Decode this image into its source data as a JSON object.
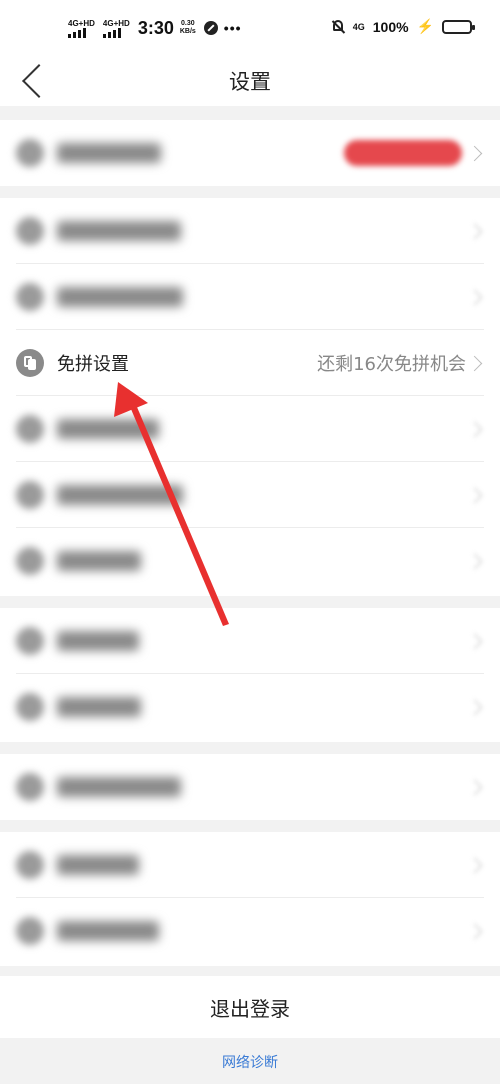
{
  "status_bar": {
    "sim1_label": "4G+HD",
    "sim2_label": "4G+HD",
    "time": "3:30",
    "speed_value": "0.30",
    "speed_unit": "KB/s",
    "more": "•••",
    "network": "4G",
    "battery_percent": "100%",
    "battery_fill_fraction": 1.0,
    "icons": [
      "signal-icon",
      "signal-icon",
      "dnd-icon",
      "mute-bell-icon",
      "network-4g-icon",
      "charging-bolt-icon",
      "battery-icon"
    ]
  },
  "navbar": {
    "title": "设置",
    "back_icon": "chevron-left-icon"
  },
  "settings": {
    "free_pin_label": "免拼设置",
    "free_pin_value": "还剩16次免拼机会"
  },
  "footer": {
    "logout_label": "退出登录",
    "network_diagnosis_label": "网络诊断"
  },
  "colors": {
    "background": "#f2f2f2",
    "card": "#ffffff",
    "accent_red": "#e5484d",
    "link_blue": "#3a7bd5",
    "annotation_arrow": "#e8302f"
  }
}
